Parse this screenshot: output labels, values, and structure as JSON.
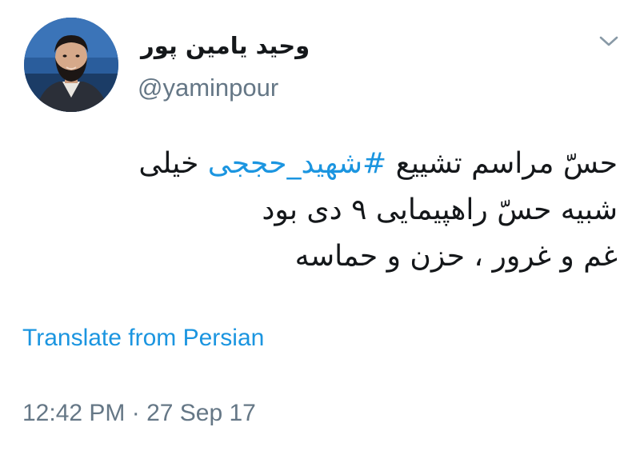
{
  "user": {
    "display_name": "وحید یامین پور",
    "handle": "@yaminpour",
    "avatar_icon": "profile-photo"
  },
  "menu": {
    "caret_icon": "chevron-down-icon"
  },
  "tweet": {
    "line1_before": "حسّ مراسم تشییع ",
    "hashtag": "#شهید_حججی",
    "line1_after": " خیلی",
    "line2": "شبیه حسّ راهپیمایی ۹ دی بود",
    "line3": "غم و غرور ، حزن و حماسه"
  },
  "translate_label": "Translate from Persian",
  "timestamp": "12:42 PM · 27 Sep 17",
  "colors": {
    "link": "#1b95e0",
    "secondary": "#657786",
    "primary_text": "#14171a"
  }
}
